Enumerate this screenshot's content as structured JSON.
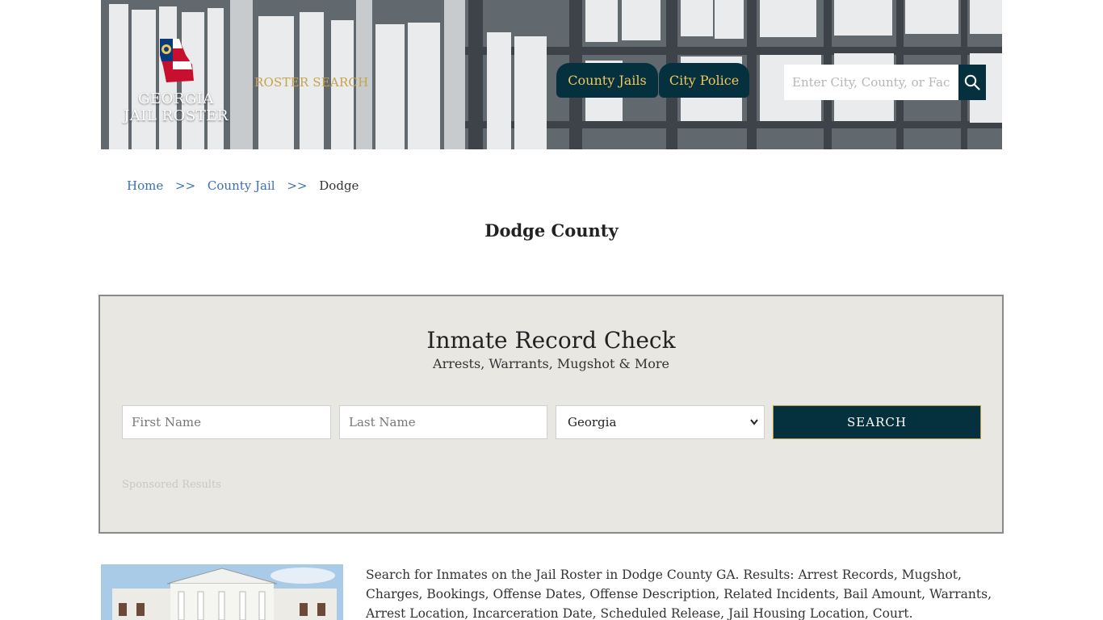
{
  "header": {
    "logo_text": "GEORGIA\nJAIL ROSTER",
    "roster_search_label": "ROSTER SEARCH",
    "nav": [
      {
        "label": "County Jails"
      },
      {
        "label": "City Police"
      }
    ],
    "search_placeholder": "Enter City, County, or Facility",
    "search_icon": "search-icon"
  },
  "breadcrumb": {
    "items": [
      "Home",
      "County Jail"
    ],
    "separator": ">>",
    "current": "Dodge"
  },
  "page_title": "Dodge County",
  "record_check": {
    "title": "Inmate Record Check",
    "subtitle": "Arrests, Warrants, Mugshot & More",
    "first_name_placeholder": "First Name",
    "last_name_placeholder": "Last Name",
    "state_selected": "Georgia",
    "search_button": "SEARCH",
    "sponsored_label": "Sponsored Results"
  },
  "description": "Search for Inmates on the Jail Roster in Dodge County GA. Results: Arrest Records, Mugshot, Charges, Bookings, Offense Dates, Offense Description, Related Incidents, Bail Amount, Warrants, Arrest Location, Incarceration Date, Scheduled Release, Jail Housing Location, Court.",
  "colors": {
    "navy": "#05313f",
    "gold": "#f0c75a",
    "link": "#3b6fb6",
    "panel_bg": "#e8e7e2"
  }
}
